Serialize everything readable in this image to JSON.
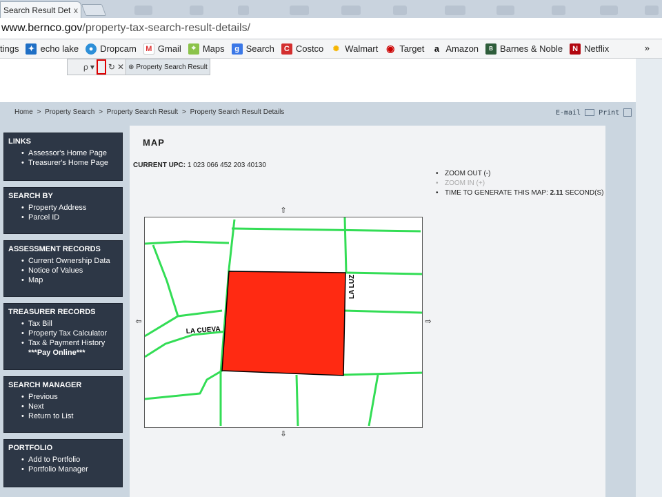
{
  "browser": {
    "active_tab_title": "Search Result Det",
    "tab_close": "x",
    "url_host": "www.bernco.gov",
    "url_path": "/property-tax-search-result-details/",
    "bookmarks": [
      {
        "label": "tings",
        "icon": "settings-icon"
      },
      {
        "label": "echo lake",
        "icon": "dropbox-icon"
      },
      {
        "label": "Dropcam",
        "icon": "map-pin-icon"
      },
      {
        "label": "Gmail",
        "icon": "gmail-icon"
      },
      {
        "label": "Maps",
        "icon": "maps-icon"
      },
      {
        "label": "Search",
        "icon": "google-search-icon"
      },
      {
        "label": "Costco",
        "icon": "costco-icon"
      },
      {
        "label": "Walmart",
        "icon": "walmart-icon"
      },
      {
        "label": "Target",
        "icon": "target-icon"
      },
      {
        "label": "Amazon",
        "icon": "amazon-icon"
      },
      {
        "label": "Barnes & Noble",
        "icon": "barnes-noble-icon"
      },
      {
        "label": "Netflix",
        "icon": "netflix-icon"
      }
    ],
    "bookmarks_more": "»"
  },
  "ie_toolbar": {
    "search_glyph": "ρ",
    "tab_label": "Property Search Result Details-..."
  },
  "breadcrumb": [
    "Home",
    ">",
    "Property Search",
    ">",
    "Property Search Result",
    ">",
    "Property Search Result Details"
  ],
  "page_actions": {
    "email": "E-mail",
    "print": "Print"
  },
  "sidebar": [
    {
      "title": "LINKS",
      "items": [
        "Assessor's Home Page",
        "Treasurer's Home Page"
      ]
    },
    {
      "title": "SEARCH BY",
      "items": [
        "Property Address",
        "Parcel ID"
      ]
    },
    {
      "title": "ASSESSMENT RECORDS",
      "items": [
        "Current Ownership Data",
        "Notice of Values",
        "Map"
      ]
    },
    {
      "title": "TREASURER RECORDS",
      "items": [
        "Tax Bill",
        "Property Tax Calculator",
        "Tax & Payment History"
      ],
      "extra": "***Pay Online***"
    },
    {
      "title": "SEARCH MANAGER",
      "items": [
        "Previous",
        "Next",
        "Return to List"
      ]
    },
    {
      "title": "PORTFOLIO",
      "items": [
        "Add to Portfolio",
        "Portfolio Manager"
      ]
    }
  ],
  "main": {
    "heading": "MAP",
    "upc_label": "CURRENT UPC:",
    "upc_value": "1 023 066 452 203 40130",
    "zoom_out": "ZOOM OUT (-)",
    "zoom_in": "ZOOM IN (+)",
    "time_label": "TIME TO GENERATE THIS MAP:",
    "time_value": "2.11",
    "time_unit": "SECOND(S)"
  },
  "map": {
    "street_1": "LA CUEVA",
    "street_2": "LA LUZ",
    "parcel_color": "#ff2a12",
    "street_color": "#33dd55"
  }
}
